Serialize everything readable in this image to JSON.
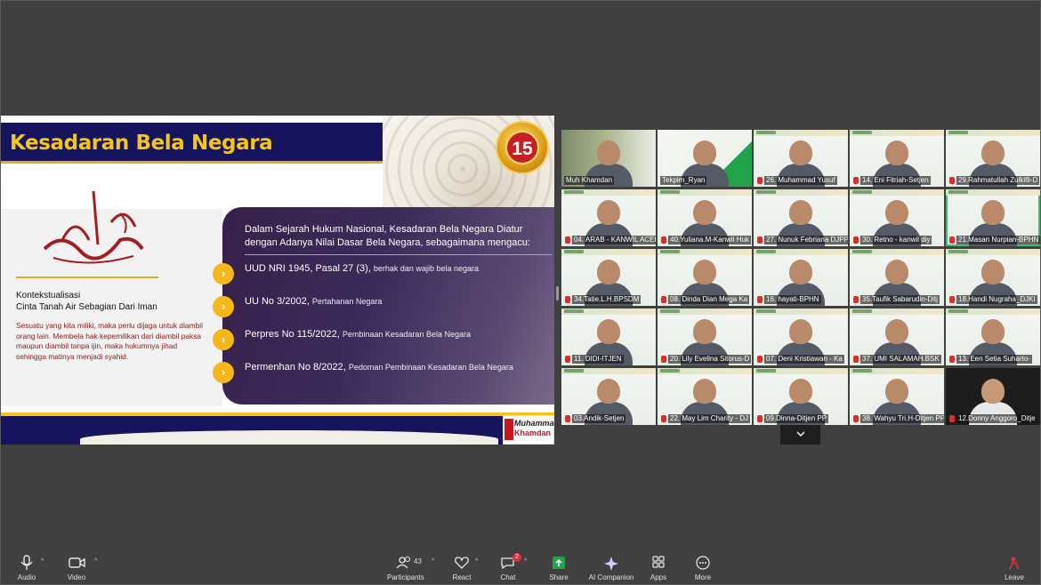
{
  "slide": {
    "title": "Kesadaran Bela Negara",
    "badge_number": "15",
    "context_title": "Kontekstualisasi",
    "context_subtitle": "Cinta Tanah Air Sebagian Dari Iman",
    "context_body": "Sesuatu yang kita miliki, maka perlu dijaga untuk diambil orang lain. Membela hak kepemilikan dari diambil paksa maupun diambil tanpa ijin, maka hukumnya jihad sehingga matinya menjadi syahid.",
    "heading": "Dalam Sejarah Hukum Nasional, Kesadaran Bela Negara Diatur dengan Adanya Nilai Dasar Bela Negara, sebagaimana mengacu:",
    "items": [
      {
        "main": "UUD NRI 1945, Pasal 27 (3),",
        "sub": "berhak dan wajib bela negara"
      },
      {
        "main": "UU No 3/2002,",
        "sub": "Pertahanan Negara"
      },
      {
        "main": "Perpres No 115/2022,",
        "sub": "Pembinaan Kesadaran Bela Negara"
      },
      {
        "main": "Permenhan No 8/2022,",
        "sub": "Pedoman Pembinaan Kesadaran Bela Negara"
      }
    ],
    "logo_line1": "Muhammad",
    "logo_line2": "Khamdan"
  },
  "participants": [
    "Muh Khamdan",
    "Tekpim_Ryan",
    "26. Muhammad Yusuf",
    "14. Eni Fitriah-Setjen",
    "29.Rahmatullah Zulkifli-D",
    "04. ARAB - KANWIL ACEH",
    "40.Yuliana.M-Kanwil Huk",
    "27. Nunuk Febriana DJPP",
    "30. Retno - kanwil diy",
    "21.Masan Nurpian-BPHN",
    "34.Tatie.L.H.BPSDM",
    "08. Dinda Dian Mega Ka",
    "16. hayati-BPHN",
    "35.Taufik Sabarudin-Ditj",
    "18.Handi Nugraha_DJKI",
    "11. DIDI-ITJEN",
    "20. Lily Evelina Sitorus-D",
    "07. Deni Kristiawan - Ka",
    "37. UMI SALAMAH.BSK",
    "13. Een Setia Suharto-",
    "03.Andik-Setjen",
    "22. May Lim Charity - DJ",
    "09.Dinna-Ditjen PP",
    "38. Wahyu Tri.H-Ditjen PP",
    "12.Donny Anggoro_Ditje"
  ],
  "toolbar": {
    "audio": "Audio",
    "video": "Video",
    "participants": "Participants",
    "participants_count": "43",
    "react": "React",
    "chat": "Chat",
    "chat_badge": "2",
    "share": "Share",
    "ai": "AI Companion",
    "apps": "Apps",
    "more": "More",
    "leave": "Leave"
  },
  "colors": {
    "accent_green": "#21a34a",
    "slide_navy": "#16145c",
    "slide_gold": "#f5c518",
    "leave_red": "#e0313b"
  }
}
